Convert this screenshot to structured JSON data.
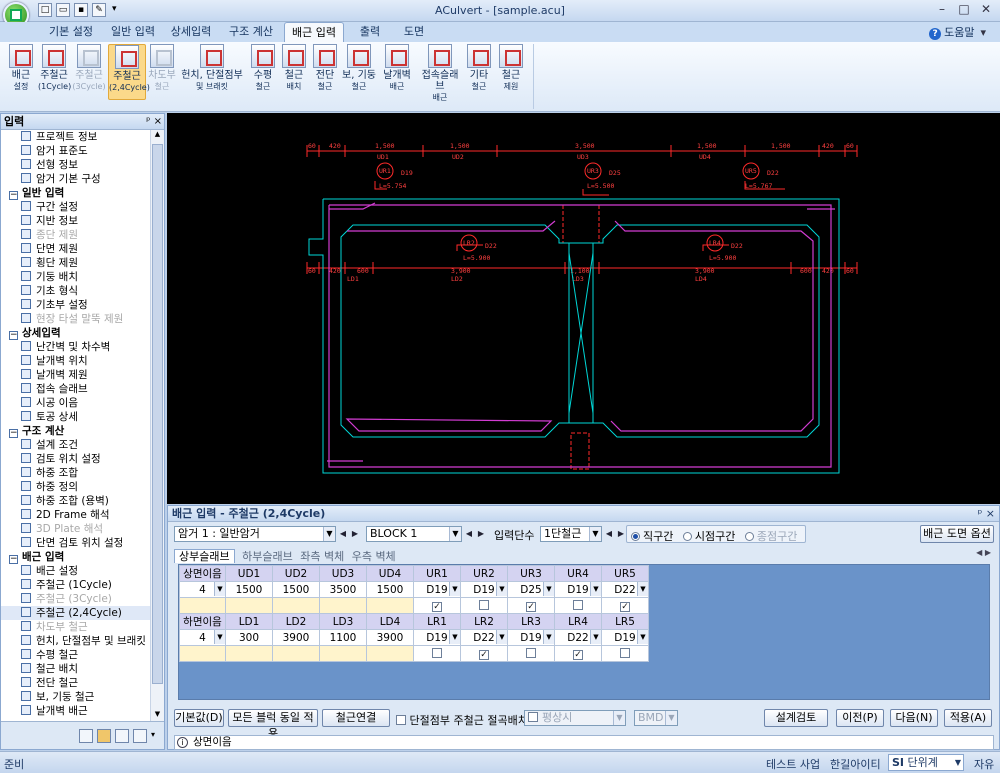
{
  "window": {
    "title": "ACulvert - [sample.acu]"
  },
  "tabs": [
    "기본 설정",
    "일반 입력",
    "상세입력",
    "구조 계산",
    "배근 입력",
    "출력",
    "도면"
  ],
  "active_tab": "배근 입력",
  "help": "도움말",
  "ribbon": [
    {
      "l1": "배근",
      "l2": "설정",
      "dis": false
    },
    {
      "l1": "주철근",
      "l2": "(1Cycle)",
      "dis": false
    },
    {
      "l1": "주철근",
      "l2": "(3Cycle)",
      "dis": true
    },
    {
      "l1": "주철근",
      "l2": "(2,4Cycle)",
      "dis": false,
      "active": true
    },
    {
      "l1": "차도부",
      "l2": "철근",
      "dis": true
    },
    {
      "l1": "헌치, 단절점부",
      "l2": "및 브래킷",
      "dis": false
    },
    {
      "l1": "수평",
      "l2": "철근",
      "dis": false
    },
    {
      "l1": "철근",
      "l2": "배치",
      "dis": false
    },
    {
      "l1": "전단",
      "l2": "철근",
      "dis": false
    },
    {
      "l1": "보, 기둥",
      "l2": "철근",
      "dis": false
    },
    {
      "l1": "날개벽",
      "l2": "배근",
      "dis": false
    },
    {
      "l1": "접속슬래브",
      "l2": "배근",
      "dis": false
    },
    {
      "l1": "기타",
      "l2": "철근",
      "dis": false
    },
    {
      "l1": "철근",
      "l2": "제원",
      "dis": false
    }
  ],
  "left_panel": {
    "title": "입력",
    "pin": "ᵖ ×"
  },
  "tree": [
    {
      "t": "프로젝트 정보"
    },
    {
      "t": "암거 표준도"
    },
    {
      "t": "선형 정보"
    },
    {
      "t": "암거 기본 구성"
    },
    {
      "t": "일반 입력",
      "grp": true
    },
    {
      "t": "구간 설정"
    },
    {
      "t": "지반 정보"
    },
    {
      "t": "종단 제원",
      "dis": true
    },
    {
      "t": "단면 제원"
    },
    {
      "t": "횡단 제원"
    },
    {
      "t": "기둥 배치"
    },
    {
      "t": "기초 형식"
    },
    {
      "t": "기초부 설정"
    },
    {
      "t": "현장 타설 말뚝 제원",
      "dis": true
    },
    {
      "t": "상세입력",
      "grp": true
    },
    {
      "t": "난간벽 및 차수벽"
    },
    {
      "t": "날개벽 위치"
    },
    {
      "t": "날개벽 제원"
    },
    {
      "t": "접속 슬래브"
    },
    {
      "t": "시공 이음"
    },
    {
      "t": "토공 상세"
    },
    {
      "t": "구조 계산",
      "grp": true
    },
    {
      "t": "설계 조건"
    },
    {
      "t": "검토 위치 설정"
    },
    {
      "t": "하중 조합"
    },
    {
      "t": "하중 정의"
    },
    {
      "t": "하중 조합 (용벽)"
    },
    {
      "t": "2D Frame 해석"
    },
    {
      "t": "3D Plate 해석",
      "dis": true
    },
    {
      "t": "단면 검토 위치 설정"
    },
    {
      "t": "배근 입력",
      "grp": true
    },
    {
      "t": "배근 설정"
    },
    {
      "t": "주철근 (1Cycle)"
    },
    {
      "t": "주철근 (3Cycle)",
      "dis": true
    },
    {
      "t": "주철근 (2,4Cycle)",
      "sel": true
    },
    {
      "t": "차도부 철근",
      "dis": true
    },
    {
      "t": "헌치, 단절점부 및 브래킷"
    },
    {
      "t": "수평 철근"
    },
    {
      "t": "철근 배치"
    },
    {
      "t": "전단 철근"
    },
    {
      "t": "보, 기둥 철근"
    },
    {
      "t": "날개벽 배근"
    }
  ],
  "drawing": {
    "top_dims": [
      "60",
      "420",
      "1,500",
      "1,500",
      "3,500",
      "1,500",
      "1,500",
      "420",
      "60"
    ],
    "top_names": [
      "UD1",
      "UD2",
      "UD3",
      "UD4"
    ],
    "bot_dims": [
      "60",
      "420",
      "600",
      "3,900",
      "1,100",
      "3,900",
      "600",
      "420",
      "60"
    ],
    "bot_names": [
      "LD1",
      "LD2",
      "LD3",
      "LD4"
    ],
    "ur1": "UR1",
    "ur1_dia": "D19",
    "ur1_len": "L=5.754",
    "ur3": "UR3",
    "ur3_dia": "D25",
    "ur3_len": "L=5.500",
    "ur5": "UR5",
    "ur5_dia": "D22",
    "ur5_len": "L=5.767",
    "lr2": "LR2",
    "lr2_dia": "D22",
    "lr2_len": "L=5.900",
    "lr4": "LR4",
    "lr4_dia": "D22",
    "lr4_len": "L=5.900"
  },
  "bottom_panel": {
    "title": "배근 입력 - 주철근 (2,4Cycle)",
    "pin": "ᵖ ×",
    "combo_culvert": "암거 1 : 일반암거",
    "combo_block": "BLOCK  1",
    "label_level": "입력단수",
    "combo_level": "1단철근",
    "radios": [
      {
        "t": "직구간",
        "on": true
      },
      {
        "t": "시점구간",
        "on": false
      },
      {
        "t": "종점구간",
        "on": false,
        "dis": true
      }
    ],
    "btn_drawing_opt": "배근 도면 옵션",
    "subtabs": [
      "상부슬래브",
      "하부슬래브",
      "좌측 벽체",
      "우측 벽체"
    ],
    "upper": {
      "head_joint": "상면이음",
      "joint_val": "4",
      "d_heads": [
        "UD1",
        "UD2",
        "UD3",
        "UD4"
      ],
      "d_vals": [
        "1500",
        "1500",
        "3500",
        "1500"
      ],
      "r_heads": [
        "UR1",
        "UR2",
        "UR3",
        "UR4",
        "UR5"
      ],
      "r_vals": [
        "D19",
        "D19",
        "D25",
        "D19",
        "D22"
      ],
      "r_checks": [
        true,
        false,
        true,
        false,
        true
      ]
    },
    "lower": {
      "head_joint": "하면이음",
      "joint_val": "4",
      "d_heads": [
        "LD1",
        "LD2",
        "LD3",
        "LD4"
      ],
      "d_vals": [
        "300",
        "3900",
        "1100",
        "3900"
      ],
      "r_heads": [
        "LR1",
        "LR2",
        "LR3",
        "LR4",
        "LR5"
      ],
      "r_vals": [
        "D19",
        "D22",
        "D19",
        "D22",
        "D19"
      ],
      "r_checks": [
        false,
        true,
        false,
        true,
        false
      ]
    },
    "btn_default": "기본값(D)",
    "btn_all_same": "모든 블럭 동일 적용",
    "btn_connect": "철근연결",
    "chk_label": "단절점부 주철근 절곡배치",
    "combo_disabled1": "평상시",
    "combo_disabled2": "BMD",
    "btn_check": "설계검토",
    "btn_prev": "이전(P)",
    "btn_next": "다음(N)",
    "btn_apply": "적용(A)",
    "status": "상면이음"
  },
  "statusbar": {
    "left": "준비",
    "proj": "테스트 사업",
    "company": "한길아이티",
    "unit_prefix": "SI",
    "unit": "단위계",
    "mode": "자유"
  },
  "colors": {
    "accent": "#fbd98a",
    "canvas": "#000000",
    "dim": "#ff2a2a",
    "cyan": "#00d7d7",
    "magenta": "#d23cd2",
    "grid_bg": "#6a93c9"
  }
}
